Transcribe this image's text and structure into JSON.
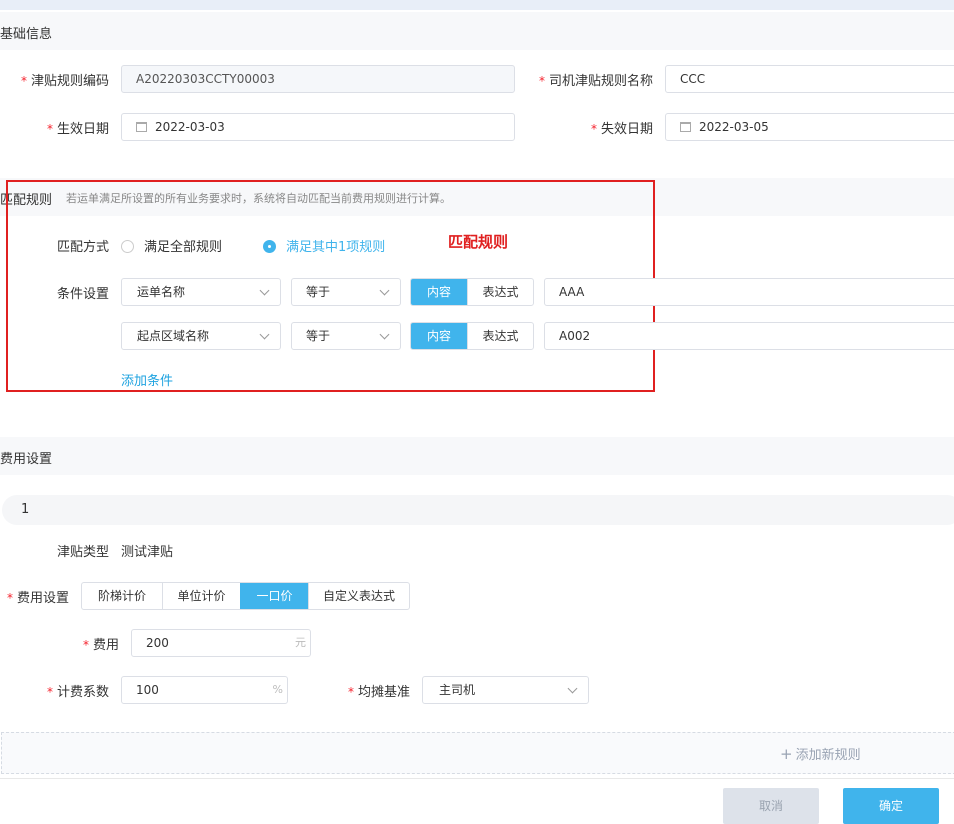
{
  "basic": {
    "title": "基础信息",
    "rule_code_label": "津贴规则编码",
    "rule_code_value": "A20220303CCTY00003",
    "rule_name_label": "司机津贴规则名称",
    "rule_name_value": "CCC",
    "effective_label": "生效日期",
    "effective_value": "2022-03-03",
    "expire_label": "失效日期",
    "expire_value": "2022-03-05"
  },
  "match": {
    "title": "匹配规则",
    "hint": "若运单满足所设置的所有业务要求时，系统将自动匹配当前费用规则进行计算。",
    "annotation": "匹配规则",
    "mode_label": "匹配方式",
    "options": [
      "满足全部规则",
      "满足其中1项规则"
    ],
    "selected_option": 1,
    "condition_label": "条件设置",
    "conditions": [
      {
        "field": "运单名称",
        "operator": "等于",
        "mode_content": "内容",
        "mode_expr": "表达式",
        "value": "AAA"
      },
      {
        "field": "起点区域名称",
        "operator": "等于",
        "mode_content": "内容",
        "mode_expr": "表达式",
        "value": "A002"
      }
    ],
    "add_condition": "添加条件"
  },
  "fee": {
    "title": "费用设置",
    "rule_index": "1",
    "allowance_type_label": "津贴类型",
    "allowance_type_value": "测试津贴",
    "fee_setting_label": "费用设置",
    "pricing_tabs": [
      "阶梯计价",
      "单位计价",
      "一口价",
      "自定义表达式"
    ],
    "selected_tab": 2,
    "amount_label": "费用",
    "amount_value": "200",
    "amount_unit": "元",
    "coef_label": "计费系数",
    "coef_value": "100",
    "coef_unit": "%",
    "share_label": "均摊基准",
    "share_value": "主司机",
    "add_rule": "添加新规则"
  },
  "footer": {
    "cancel": "取消",
    "confirm": "确定"
  },
  "colors": {
    "accent": "#40b4ec",
    "annotation_red": "#e02020",
    "required": "#f5222d"
  }
}
